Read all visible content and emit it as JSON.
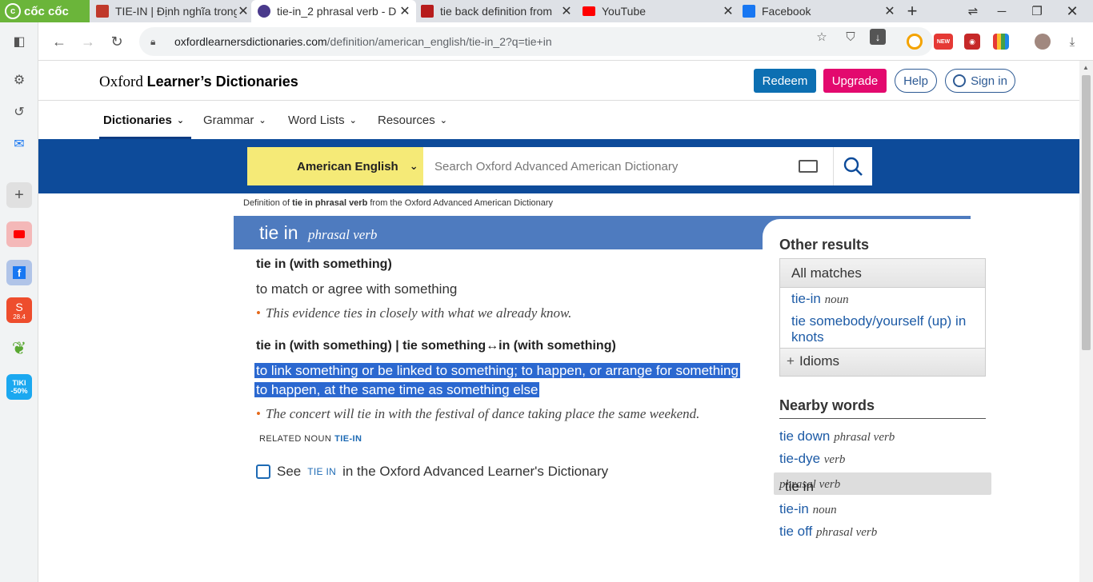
{
  "browser": {
    "brand": "cốc cốc",
    "tabs": [
      {
        "title": "TIE-IN | Định nghĩa trong",
        "fav_color": "#c0392b"
      },
      {
        "title": "tie-in_2 phrasal verb - D",
        "fav_color": "#4a3a8c",
        "active": true
      },
      {
        "title": "tie back definition from",
        "fav_color": "#b71c1c"
      },
      {
        "title": "YouTube",
        "fav_color": "#ff0000"
      },
      {
        "title": "Facebook",
        "fav_color": "#1877f2"
      }
    ],
    "url_domain": "oxfordlearnersdictionaries.com",
    "url_path": "/definition/american_english/tie-in_2?q=tie+in",
    "ext_new": "NEW"
  },
  "sidebar": {
    "tiki": "TIKI",
    "tiki_sale": "-50%",
    "shopee_date": "28.4"
  },
  "site": {
    "logo_oxford": "Oxford",
    "logo_rest": "Learner’s Dictionaries",
    "redeem": "Redeem",
    "upgrade": "Upgrade",
    "help": "Help",
    "signin": "Sign in",
    "menu": [
      "Dictionaries",
      "Grammar",
      "Word Lists",
      "Resources"
    ],
    "dict_select": "American English",
    "search_placeholder": "Search Oxford Advanced American Dictionary"
  },
  "entry": {
    "crumb_pre": "Definition of ",
    "crumb_bold": "tie in phrasal verb",
    "crumb_post": " from the Oxford Advanced American Dictionary",
    "headword": "tie in",
    "pos": "phrasal verb",
    "sense1_gram": "tie in (with something)",
    "sense1_def": "to match or agree with something",
    "sense1_ex": "This evidence ties in closely with what we already know.",
    "sense2_gram": "tie in (with something) | tie something↔in (with something)",
    "sense2_def": "to link something or be linked to something; to happen, or arrange for something to happen, at the same time as something else",
    "sense2_ex": "The concert will tie in with the festival of dance taking place the same weekend.",
    "related_label": "RELATED NOUN",
    "related_link": "TIE-IN",
    "see_pre": "See",
    "see_link": "tie in",
    "see_post": "in the Oxford Advanced Learner's Dictionary"
  },
  "other_results": {
    "title": "Other results",
    "all_matches": "All matches",
    "items": [
      {
        "word": "tie-in",
        "pos": "noun"
      },
      {
        "word": "tie somebody/yourself (up) in knots",
        "pos": ""
      }
    ],
    "idioms": "Idioms"
  },
  "nearby": {
    "title": "Nearby words",
    "items": [
      {
        "word": "tie down",
        "pos": "phrasal verb"
      },
      {
        "word": "tie-dye",
        "pos": "verb"
      },
      {
        "word": "tie in",
        "pos": "phrasal verb",
        "selected": true
      },
      {
        "word": "tie-in",
        "pos": "noun"
      },
      {
        "word": "tie off",
        "pos": "phrasal verb"
      }
    ]
  }
}
